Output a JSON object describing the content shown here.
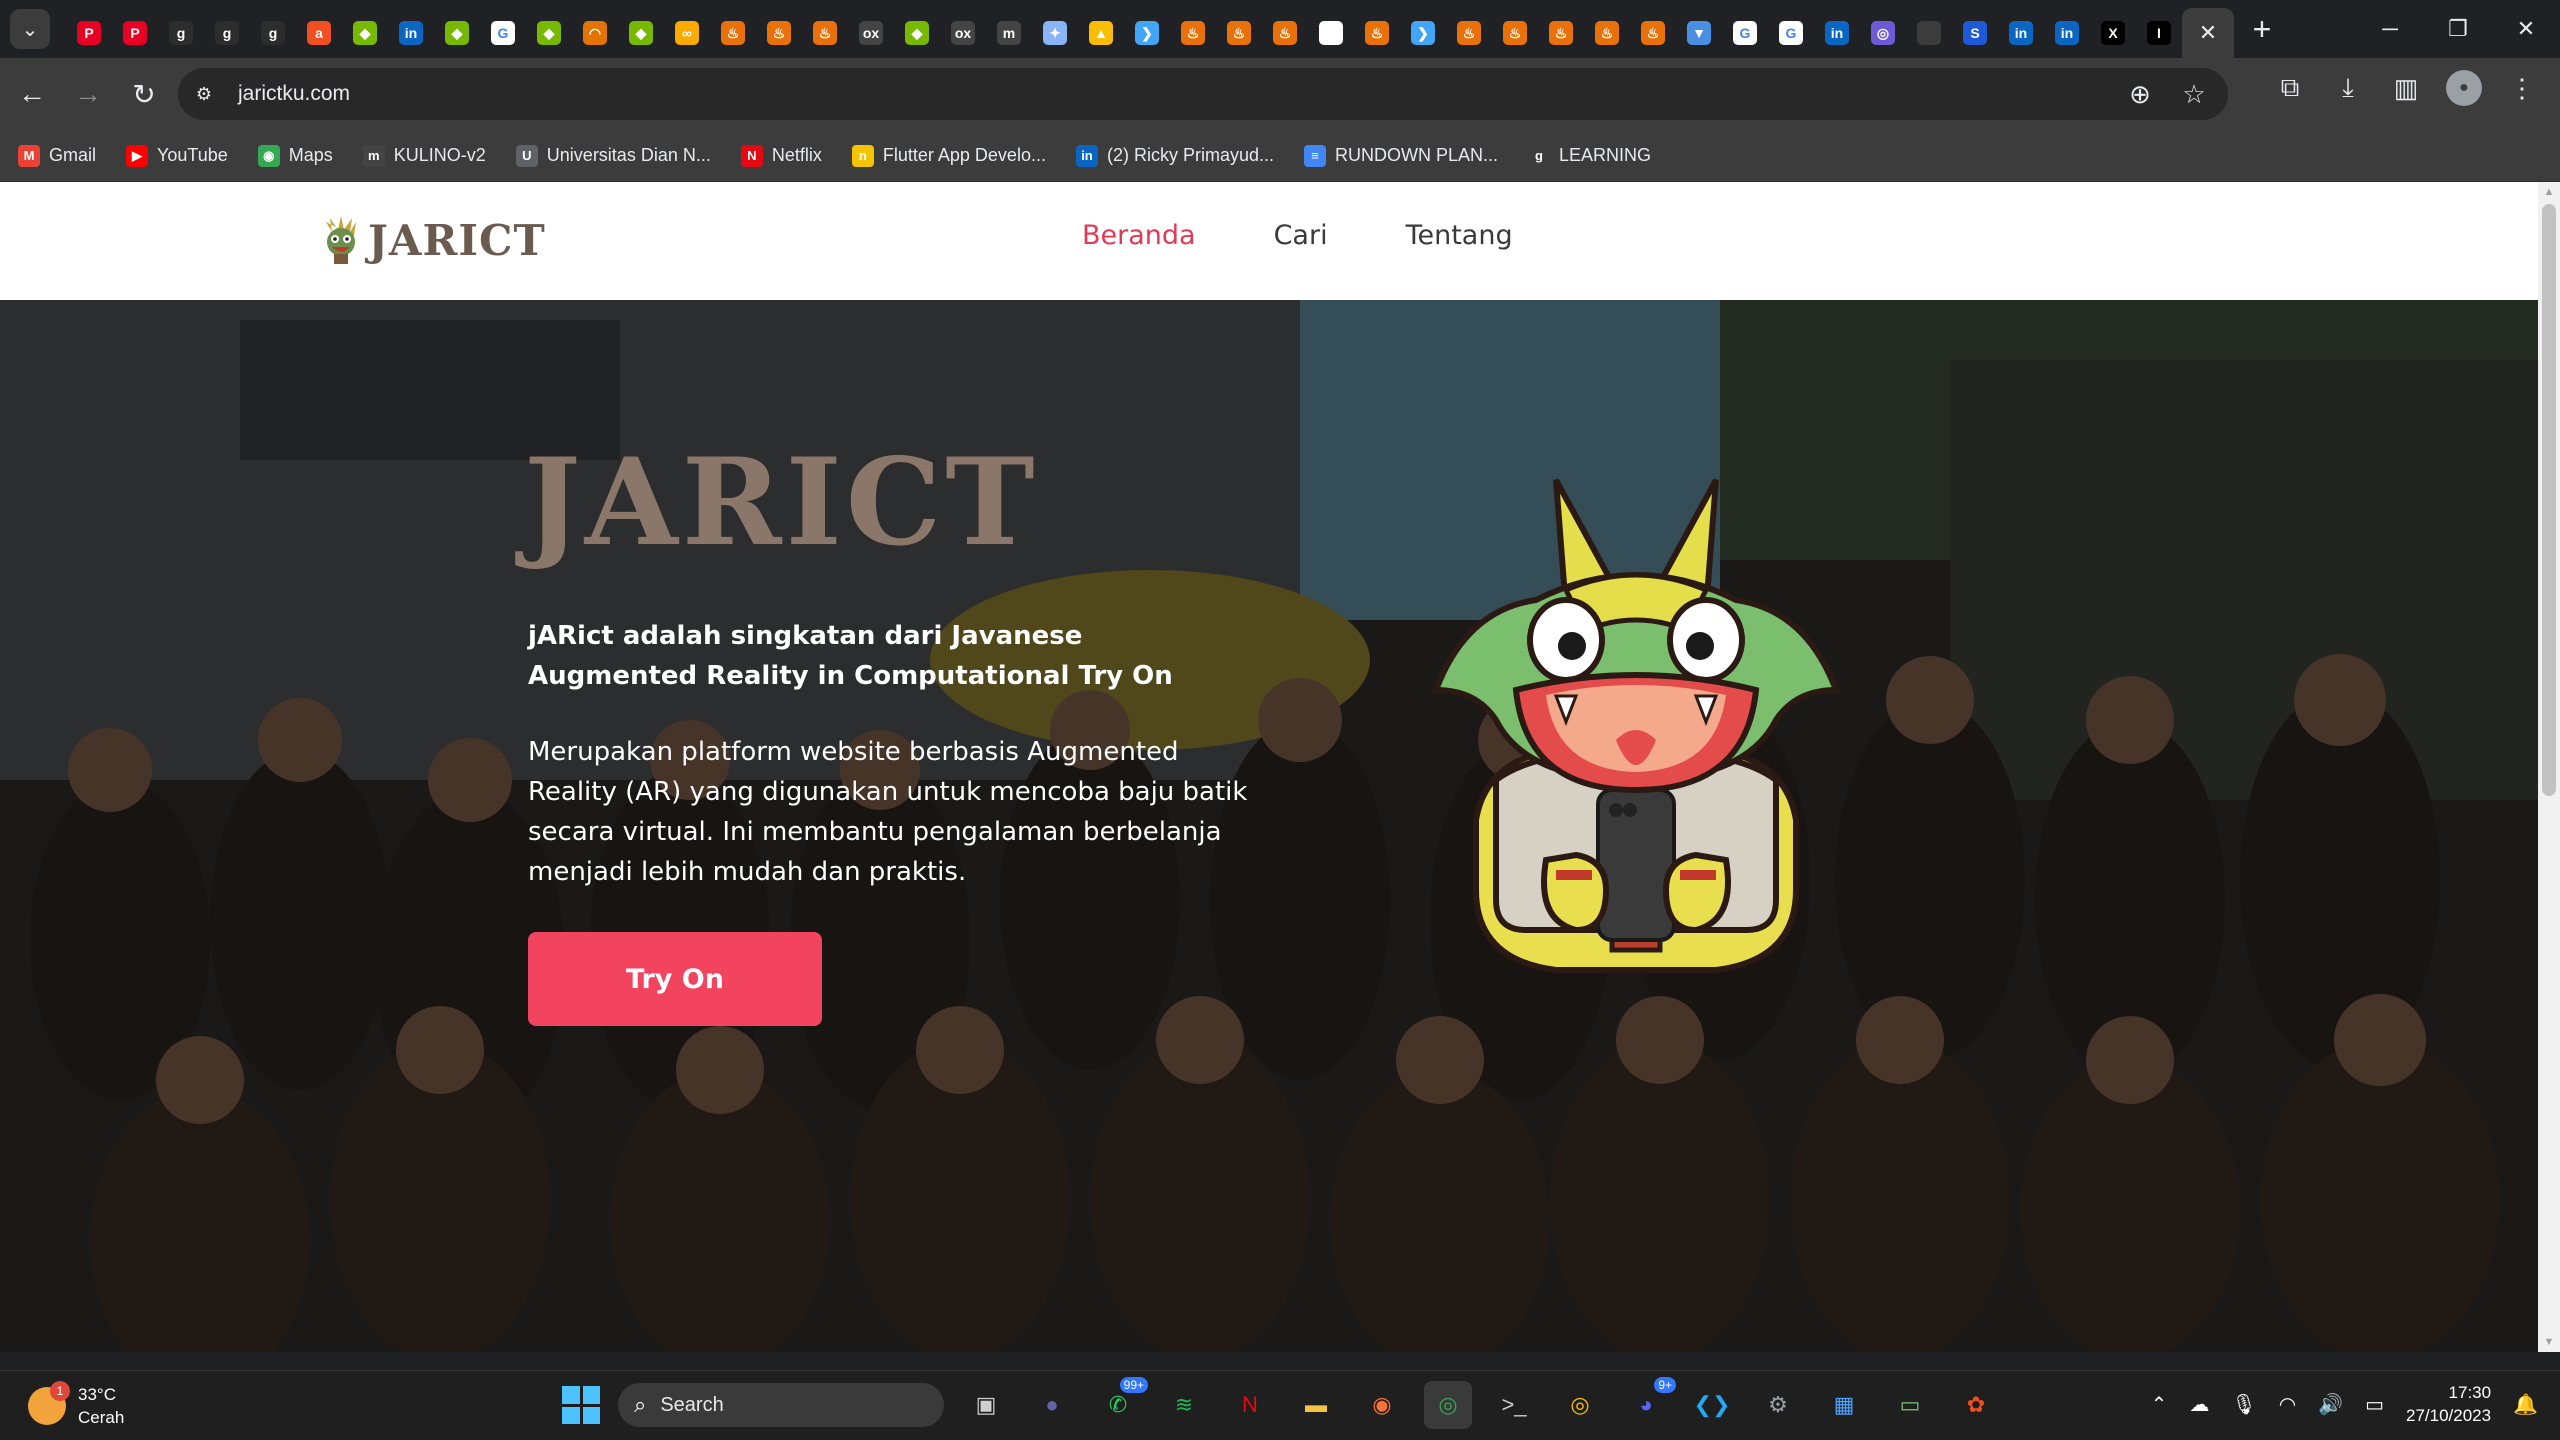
{
  "browser": {
    "tab_favicons": [
      {
        "icon": "pinterest",
        "color": "#e60023",
        "glyph": "P"
      },
      {
        "icon": "pinterest",
        "color": "#e60023",
        "glyph": "P"
      },
      {
        "icon": "g",
        "color": "#2d2d2d",
        "glyph": "g"
      },
      {
        "icon": "g",
        "color": "#2d2d2d",
        "glyph": "g"
      },
      {
        "icon": "g",
        "color": "#2d2d2d",
        "glyph": "g"
      },
      {
        "icon": "ada",
        "color": "#f25022",
        "glyph": "a"
      },
      {
        "icon": "nvidia",
        "color": "#76b900",
        "glyph": "◆"
      },
      {
        "icon": "linkedin",
        "color": "#0a66c2",
        "glyph": "in"
      },
      {
        "icon": "nvidia",
        "color": "#76b900",
        "glyph": "◆"
      },
      {
        "icon": "google",
        "color": "#ffffff",
        "glyph": "G"
      },
      {
        "icon": "nvidia",
        "color": "#76b900",
        "glyph": "◆"
      },
      {
        "icon": "loading",
        "color": "#e37400",
        "glyph": "◠"
      },
      {
        "icon": "nvidia",
        "color": "#76b900",
        "glyph": "◆"
      },
      {
        "icon": "infinity",
        "color": "#f9ab00",
        "glyph": "∞"
      },
      {
        "icon": "fire",
        "color": "#e8710a",
        "glyph": "♨"
      },
      {
        "icon": "fire",
        "color": "#e8710a",
        "glyph": "♨"
      },
      {
        "icon": "fire",
        "color": "#e8710a",
        "glyph": "♨"
      },
      {
        "icon": "xs",
        "color": "#444444",
        "glyph": "ox"
      },
      {
        "icon": "nvidia",
        "color": "#76b900",
        "glyph": "◆"
      },
      {
        "icon": "xs",
        "color": "#444444",
        "glyph": "ox"
      },
      {
        "icon": "m",
        "color": "#444444",
        "glyph": "m"
      },
      {
        "icon": "gemini",
        "color": "#8ab4f8",
        "glyph": "✦"
      },
      {
        "icon": "drive",
        "color": "#fbbc04",
        "glyph": "▲"
      },
      {
        "icon": "flutter",
        "color": "#42a5f5",
        "glyph": "❯"
      },
      {
        "icon": "fire",
        "color": "#e8710a",
        "glyph": "♨"
      },
      {
        "icon": "fire",
        "color": "#e8710a",
        "glyph": "♨"
      },
      {
        "icon": "fire",
        "color": "#e8710a",
        "glyph": "♨"
      },
      {
        "icon": "medium",
        "color": "#ffffff",
        "glyph": "●●"
      },
      {
        "icon": "fire",
        "color": "#e8710a",
        "glyph": "♨"
      },
      {
        "icon": "flutter",
        "color": "#42a5f5",
        "glyph": "❯"
      },
      {
        "icon": "fire",
        "color": "#e8710a",
        "glyph": "♨"
      },
      {
        "icon": "fire",
        "color": "#e8710a",
        "glyph": "♨"
      },
      {
        "icon": "fire",
        "color": "#e8710a",
        "glyph": "♨"
      },
      {
        "icon": "fire",
        "color": "#e8710a",
        "glyph": "♨"
      },
      {
        "icon": "fire",
        "color": "#e8710a",
        "glyph": "♨"
      },
      {
        "icon": "bluesky",
        "color": "#4a90e2",
        "glyph": "▼"
      },
      {
        "icon": "google",
        "color": "#ffffff",
        "glyph": "G"
      },
      {
        "icon": "google",
        "color": "#ffffff",
        "glyph": "G"
      },
      {
        "icon": "linkedin",
        "color": "#0a66c2",
        "glyph": "in"
      },
      {
        "icon": "purple",
        "color": "#6e5ad6",
        "glyph": "◎"
      },
      {
        "icon": "blank",
        "color": "#3c3c3c",
        "glyph": ""
      },
      {
        "icon": "s",
        "color": "#1e5ad6",
        "glyph": "S"
      },
      {
        "icon": "linkedin",
        "color": "#0a66c2",
        "glyph": "in"
      },
      {
        "icon": "linkedin",
        "color": "#0a66c2",
        "glyph": "in"
      },
      {
        "icon": "x",
        "color": "#000000",
        "glyph": "X"
      },
      {
        "icon": "i",
        "color": "#000000",
        "glyph": "I"
      }
    ],
    "url": "jarictku.com",
    "bookmarks": [
      {
        "label": "Gmail",
        "icon": "gmail-icon",
        "color": "#ea4335",
        "glyph": "M"
      },
      {
        "label": "YouTube",
        "icon": "youtube-icon",
        "color": "#ff0000",
        "glyph": "▶"
      },
      {
        "label": "Maps",
        "icon": "maps-icon",
        "color": "#34a853",
        "glyph": "◉"
      },
      {
        "label": "KULINO-v2",
        "icon": "kulino-icon",
        "color": "#444444",
        "glyph": "m"
      },
      {
        "label": "Universitas Dian N...",
        "icon": "udinus-icon",
        "color": "#5f6368",
        "glyph": "U"
      },
      {
        "label": "Netflix",
        "icon": "netflix-icon",
        "color": "#e50914",
        "glyph": "N"
      },
      {
        "label": "Flutter App Develo...",
        "icon": "flutter-bookmark-icon",
        "color": "#f5c400",
        "glyph": "n"
      },
      {
        "label": "(2) Ricky Primayud...",
        "icon": "linkedin-bookmark-icon",
        "color": "#0a66c2",
        "glyph": "in"
      },
      {
        "label": "RUNDOWN PLAN...",
        "icon": "docs-icon",
        "color": "#4285f4",
        "glyph": "≡"
      },
      {
        "label": "LEARNING",
        "icon": "learning-icon",
        "color": "#3c3c3c",
        "glyph": "g"
      }
    ]
  },
  "site": {
    "logo_text": "JARICT",
    "nav": [
      {
        "label": "Beranda",
        "active": true
      },
      {
        "label": "Cari",
        "active": false
      },
      {
        "label": "Tentang",
        "active": false
      }
    ],
    "hero": {
      "title": "JARICT",
      "subtitle": "jARict adalah singkatan dari Javanese Augmented Reality in Computational Try On",
      "description": "Merupakan platform website berbasis Augmented Reality (AR) yang digunakan untuk mencoba baju batik secara virtual. Ini membantu pengalaman berbelanja menjadi lebih mudah dan praktis.",
      "cta_label": "Try On"
    },
    "colors": {
      "accent": "#f2435f",
      "nav_active": "#e23a55",
      "logo": "#6b5a4e"
    }
  },
  "taskbar": {
    "weather": {
      "temp": "33°C",
      "condition": "Cerah",
      "badge": "1"
    },
    "search_label": "Search",
    "apps": [
      {
        "name": "task-view-icon",
        "glyph": "▣",
        "color": "#cfcfcf",
        "badge": ""
      },
      {
        "name": "teams-icon",
        "glyph": "●",
        "color": "#6264a7",
        "badge": ""
      },
      {
        "name": "whatsapp-icon",
        "glyph": "✆",
        "color": "#25d366",
        "badge": "99+"
      },
      {
        "name": "spotify-icon",
        "glyph": "≋",
        "color": "#1db954",
        "badge": ""
      },
      {
        "name": "netflix-icon",
        "glyph": "N",
        "color": "#e50914",
        "badge": ""
      },
      {
        "name": "file-explorer-icon",
        "glyph": "▬",
        "color": "#f6c244",
        "badge": ""
      },
      {
        "name": "firefox-icon",
        "glyph": "◉",
        "color": "#ff7139",
        "badge": ""
      },
      {
        "name": "chrome-icon",
        "glyph": "◎",
        "color": "#34a853",
        "badge": ""
      },
      {
        "name": "terminal-icon",
        "glyph": ">_",
        "color": "#cccccc",
        "badge": ""
      },
      {
        "name": "chrome-dev-icon",
        "glyph": "◎",
        "color": "#fbbc04",
        "badge": ""
      },
      {
        "name": "discord-icon",
        "glyph": "◕",
        "color": "#5865f2",
        "badge": "9+"
      },
      {
        "name": "vscode-icon",
        "glyph": "❮❯",
        "color": "#23a9f2",
        "badge": ""
      },
      {
        "name": "settings-icon",
        "glyph": "⚙",
        "color": "#9aa0a6",
        "badge": ""
      },
      {
        "name": "remote-desktop-icon",
        "glyph": "▦",
        "color": "#4da3ff",
        "badge": ""
      },
      {
        "name": "game-icon",
        "glyph": "▭",
        "color": "#7ec07e",
        "badge": ""
      },
      {
        "name": "figma-icon",
        "glyph": "✿",
        "color": "#f24e1e",
        "badge": ""
      }
    ],
    "clock": {
      "time": "17:30",
      "date": "27/10/2023"
    }
  }
}
